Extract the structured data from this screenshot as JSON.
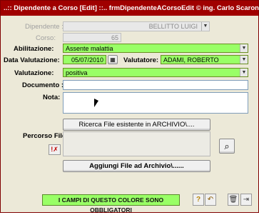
{
  "window": {
    "title": "..:: Dipendente a Corso [Edit] ::..    frmDipendenteACorsoEdit © ing. Carlo Scaroni"
  },
  "form": {
    "dipendente": {
      "label": "Dipendente :",
      "value": "BELLITTO  LUIGI"
    },
    "corso": {
      "label": "Corso:",
      "value": "65"
    },
    "abilitazione": {
      "label": "Abilitazione:",
      "value": "Assente malattia"
    },
    "data_valutazione": {
      "label": "Data Valutazione:",
      "value": "05/07/2010"
    },
    "valutatore": {
      "label": "Valutatore:",
      "value": "ADAMI, ROBERTO"
    },
    "valutazione": {
      "label": "Valutazione:",
      "value": "positiva"
    },
    "documento": {
      "label": "Documento :",
      "value": ""
    },
    "nota": {
      "label": "Nota:",
      "value": ""
    },
    "percorso_file": {
      "label": "Percorso File",
      "value": ""
    }
  },
  "buttons": {
    "ricerca": "Ricerca File esistente in ARCHIVIO\\....",
    "aggiungi": "Aggiungi File ad Archivio\\......"
  },
  "status": {
    "text": "I CAMPI DI QUESTO COLORE SONO OBBLIGATORI"
  },
  "icons": {
    "calendar": "calendar-icon",
    "clear_path": "clear-path-icon",
    "search": "magnifier-icon",
    "help": "help-icon",
    "undo": "undo-icon",
    "delete": "trash-icon",
    "exit": "exit-door-icon"
  }
}
